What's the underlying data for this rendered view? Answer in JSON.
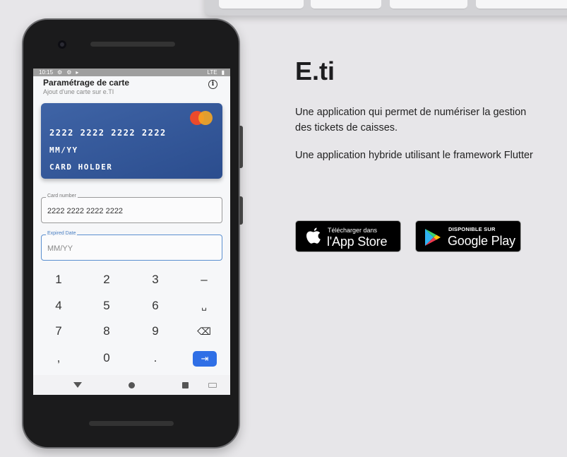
{
  "phone": {
    "status": {
      "time": "10:15",
      "network": "LTE"
    },
    "appbar": {
      "title": "Paramétrage de carte",
      "subtitle": "Ajout d'une carte sur e.TI"
    },
    "card": {
      "number": "2222 2222 2222 2222",
      "expiry": "MM/YY",
      "holder": "CARD HOLDER"
    },
    "fields": [
      {
        "label": "Card number",
        "value": "2222 2222 2222 2222"
      },
      {
        "label": "Expired Date",
        "placeholder": "MM/YY"
      }
    ],
    "keypad": [
      [
        "1",
        "2",
        "3",
        "–"
      ],
      [
        "4",
        "5",
        "6",
        "␣"
      ],
      [
        "7",
        "8",
        "9",
        "⌫"
      ],
      [
        ",",
        "0",
        ".",
        "⇥"
      ]
    ]
  },
  "content": {
    "title": "E.ti",
    "description": "Une application qui permet de numériser la gestion des tickets de caisses.",
    "framework": "Une application hybride utilisant le framework Flutter"
  },
  "stores": {
    "appstore": {
      "small": "Télécharger dans",
      "big": "l'App Store",
      "icon": "apple-icon"
    },
    "googleplay": {
      "small": "DISPONIBLE SUR",
      "big": "Google Play",
      "icon": "google-play-icon"
    }
  },
  "colors": {
    "card": "#3f64a6",
    "accent": "#2f6fe6",
    "background": "#e7e6e9"
  }
}
